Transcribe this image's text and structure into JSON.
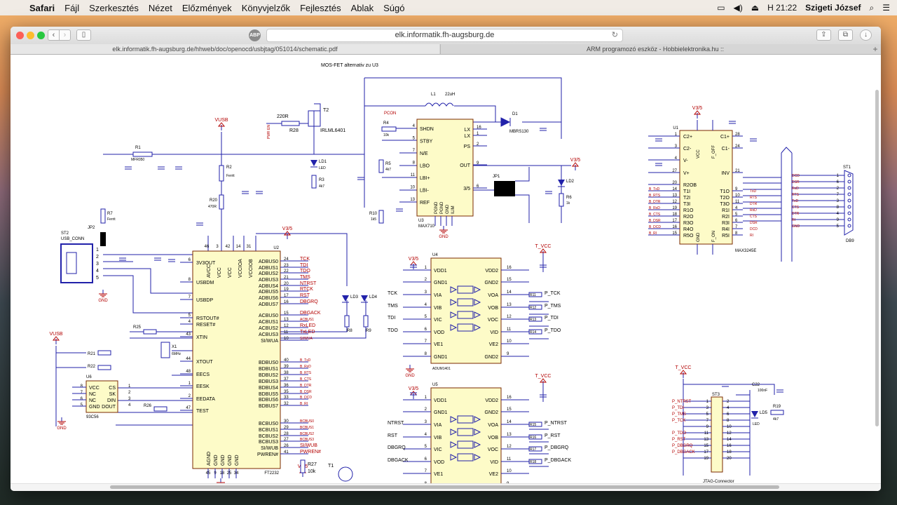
{
  "menubar": {
    "apple": "",
    "items": [
      "Safari",
      "Fájl",
      "Szerkesztés",
      "Nézet",
      "Előzmények",
      "Könyvjelzők",
      "Fejlesztés",
      "Ablak",
      "Súgó"
    ],
    "clock": "H 21:22",
    "user": "Szigeti József"
  },
  "browser": {
    "url": "elk.informatik.fh-augsburg.de",
    "adblock_label": "ABP",
    "tabs": [
      {
        "title": "elk.informatik.fh-augsburg.de/hhweb/doc/openocd/usbjtag/051014/schematic.pdf",
        "active": true
      },
      {
        "title": "ARM programozó eszköz - Hobbielektronika.hu ::",
        "active": false
      }
    ],
    "new_tab": "+"
  },
  "schematic": {
    "mosfet_note": "MOS-FET alternativ zu U3",
    "power_labels": {
      "vusb": "VUSB",
      "v3v5": "V3/5",
      "tvcc": "T_VCC"
    },
    "ft2232": {
      "ref": "U2",
      "name": "FT2232",
      "left_pins": [
        {
          "num": "6",
          "name": "3V3OUT"
        },
        {
          "num": "8",
          "name": "USBDM"
        },
        {
          "num": "7",
          "name": "USBDP"
        },
        {
          "num": "5",
          "name": "RSTOUT#"
        },
        {
          "num": "4",
          "name": "RESET#"
        },
        {
          "num": "43",
          "name": "XTIN"
        },
        {
          "num": "44",
          "name": "XTOUT"
        },
        {
          "num": "48",
          "name": "EECS"
        },
        {
          "num": "1",
          "name": "EESK"
        },
        {
          "num": "2",
          "name": "EEDATA"
        },
        {
          "num": "47",
          "name": "TEST"
        }
      ],
      "top_pins": [
        "AVCC",
        "VCC",
        "VCC",
        "VCCIOA",
        "VCCIOB"
      ],
      "top_nums": [
        "46",
        "3",
        "42",
        "14",
        "31"
      ],
      "bottom_pins": [
        "AGND",
        "GND",
        "GND",
        "GND",
        "GND"
      ],
      "bottom_nums": [
        "45",
        "9",
        "18",
        "25",
        "34"
      ],
      "right_pins": [
        {
          "num": "24",
          "name": "ADBUS0",
          "net": "TCK"
        },
        {
          "num": "23",
          "name": "ADBUS1",
          "net": "TDI"
        },
        {
          "num": "22",
          "name": "ADBUS2",
          "net": "TDO"
        },
        {
          "num": "21",
          "name": "ADBUS3",
          "net": "TMS"
        },
        {
          "num": "20",
          "name": "ADBUS4",
          "net": "NTRST"
        },
        {
          "num": "19",
          "name": "ADBUS5",
          "net": "RTCK"
        },
        {
          "num": "17",
          "name": "ADBUS6",
          "net": "RST"
        },
        {
          "num": "16",
          "name": "ADBUS7",
          "net": "DBGRQ"
        },
        {
          "num": "15",
          "name": "ACBUS0",
          "net": "DBGACK"
        },
        {
          "num": "13",
          "name": "ACBUS1",
          "net": "ACBUS1"
        },
        {
          "num": "12",
          "name": "ACBUS2",
          "net": "RxLED"
        },
        {
          "num": "11",
          "name": "ACBUS3",
          "net": "TxLED"
        },
        {
          "num": "10",
          "name": "SI/WUA",
          "net": "SI/WUA"
        },
        {
          "num": "40",
          "name": "BDBUS0",
          "net": "B_TxD"
        },
        {
          "num": "39",
          "name": "BDBUS1",
          "net": "B_RxD"
        },
        {
          "num": "38",
          "name": "BDBUS2",
          "net": "B_RTS"
        },
        {
          "num": "37",
          "name": "BDBUS3",
          "net": "B_CTS"
        },
        {
          "num": "36",
          "name": "BDBUS4",
          "net": "B_DTR"
        },
        {
          "num": "35",
          "name": "BDBUS5",
          "net": "B_DSR"
        },
        {
          "num": "33",
          "name": "BDBUS6",
          "net": "B_DCD"
        },
        {
          "num": "32",
          "name": "BDBUS7",
          "net": "B_RI"
        },
        {
          "num": "30",
          "name": "BCBUS0",
          "net": "BCBUS0"
        },
        {
          "num": "29",
          "name": "BCBUS1",
          "net": "BCBUS1"
        },
        {
          "num": "28",
          "name": "BCBUS2",
          "net": "BCBUS2"
        },
        {
          "num": "27",
          "name": "BCBUS3",
          "net": "BCBUS3"
        },
        {
          "num": "26",
          "name": "SI/WUB",
          "net": "SI/WUB"
        },
        {
          "num": "41",
          "name": "PWREN#",
          "net": "PWREN#"
        }
      ]
    },
    "max710": {
      "ref": "U3",
      "name": "MAX710",
      "left_pins": [
        {
          "num": "4",
          "name": "SHDN"
        },
        {
          "num": "5",
          "name": "STBY"
        },
        {
          "num": "7",
          "name": "N/E"
        },
        {
          "num": "8",
          "name": "LBO"
        },
        {
          "num": "11",
          "name": "LBI+"
        },
        {
          "num": "10",
          "name": "LBI-"
        },
        {
          "num": "13",
          "name": "REF"
        }
      ],
      "right_pins": [
        {
          "num": "16",
          "name": "LX"
        },
        {
          "num": "1",
          "name": "LX"
        },
        {
          "num": "2",
          "name": "PS"
        },
        {
          "num": "9",
          "name": "OUT"
        },
        {
          "num": "6",
          "name": "3/5"
        }
      ],
      "bottom_pins": [
        "PGND",
        "PGND",
        "GND",
        "ILIM"
      ],
      "net_pcon": "PCON"
    },
    "max3245": {
      "ref": "U1",
      "name": "MAX3245E",
      "left_pins": [
        {
          "num": "1",
          "name": "C2+"
        },
        {
          "num": "3",
          "name": "C2-"
        },
        {
          "num": "4",
          "name": "V-"
        },
        {
          "num": "27",
          "name": "V+"
        },
        {
          "num": "20",
          "name": "R2OB"
        },
        {
          "num": "14",
          "name": "T1I"
        },
        {
          "num": "13",
          "name": "T2I"
        },
        {
          "num": "12",
          "name": "T3I"
        },
        {
          "num": "19",
          "name": "R1O"
        },
        {
          "num": "18",
          "name": "R2O"
        },
        {
          "num": "17",
          "name": "R3O"
        },
        {
          "num": "16",
          "name": "R4O"
        },
        {
          "num": "15",
          "name": "R5O"
        }
      ],
      "left_nets": [
        "",
        "",
        "",
        "",
        "",
        "B_TxD",
        "B_RTS",
        "B_DTR",
        "B_RxD",
        "B_CTS",
        "B_DSR",
        "B_DCD",
        "B_RI"
      ],
      "right_pins": [
        {
          "num": "28",
          "name": "C1+"
        },
        {
          "num": "24",
          "name": "C1-"
        },
        {
          "num": "21",
          "name": "INV"
        },
        {
          "num": "9",
          "name": "T1O"
        },
        {
          "num": "10",
          "name": "T2O"
        },
        {
          "num": "11",
          "name": "T3O"
        },
        {
          "num": "4",
          "name": "R1I"
        },
        {
          "num": "5",
          "name": "R2I"
        },
        {
          "num": "6",
          "name": "R3I"
        },
        {
          "num": "7",
          "name": "R4I"
        },
        {
          "num": "8",
          "name": "R5I"
        }
      ],
      "right_nets": [
        "",
        "",
        "",
        "TxD",
        "RTS",
        "DTR",
        "RxD",
        "CTS",
        "DSR",
        "DCD",
        "RI"
      ],
      "top": [
        "VCC",
        "F_OFF"
      ],
      "bottom": [
        "GND",
        "F_ON"
      ]
    },
    "db9": {
      "ref": "ST1",
      "name": "DB9",
      "nets": [
        "DCD",
        "DSR",
        "RxD",
        "RTS",
        "TxD",
        "CTS",
        "DTR",
        "RI",
        "GND"
      ],
      "pins": [
        "1",
        "6",
        "2",
        "7",
        "3",
        "8",
        "4",
        "9",
        "5"
      ]
    },
    "adum_a": {
      "ref": "U4",
      "name": "ADUM1401",
      "left": [
        {
          "num": "1",
          "name": "VDD1"
        },
        {
          "num": "2",
          "name": "GND1"
        },
        {
          "num": "3",
          "name": "VIA",
          "net": "TCK"
        },
        {
          "num": "4",
          "name": "VIB",
          "net": "TMS"
        },
        {
          "num": "5",
          "name": "VIC",
          "net": "TDI"
        },
        {
          "num": "6",
          "name": "VOD",
          "net": "TDO"
        },
        {
          "num": "7",
          "name": "VE1"
        },
        {
          "num": "8",
          "name": "GND1"
        }
      ],
      "right": [
        {
          "num": "16",
          "name": "VDD2"
        },
        {
          "num": "15",
          "name": "GND2"
        },
        {
          "num": "14",
          "name": "VOA",
          "net": "P_TCK",
          "res": "R11"
        },
        {
          "num": "13",
          "name": "VOB",
          "net": "P_TMS",
          "res": "R12"
        },
        {
          "num": "12",
          "name": "VOC",
          "net": "P_TDI",
          "res": "R13"
        },
        {
          "num": "11",
          "name": "VID",
          "net": "P_TDO",
          "res": "R14"
        },
        {
          "num": "10",
          "name": "VE2"
        },
        {
          "num": "9",
          "name": "GND2"
        }
      ]
    },
    "adum_b": {
      "ref": "U5",
      "name": "ADUM1401",
      "left": [
        {
          "num": "1",
          "name": "VDD1"
        },
        {
          "num": "2",
          "name": "GND1"
        },
        {
          "num": "3",
          "name": "VIA",
          "net": "NTRST"
        },
        {
          "num": "4",
          "name": "VIB",
          "net": "RST"
        },
        {
          "num": "5",
          "name": "VIC",
          "net": "DBGRQ"
        },
        {
          "num": "6",
          "name": "VOD",
          "net": "DBGACK"
        },
        {
          "num": "7",
          "name": "VE1"
        },
        {
          "num": "8",
          "name": "GND1"
        }
      ],
      "right": [
        {
          "num": "16",
          "name": "VDD2"
        },
        {
          "num": "15",
          "name": "GND2"
        },
        {
          "num": "14",
          "name": "VOA",
          "net": "P_NTRST",
          "res": "R15"
        },
        {
          "num": "13",
          "name": "VOB",
          "net": "P_RST",
          "res": "R16"
        },
        {
          "num": "12",
          "name": "VOC",
          "net": "P_DBGRQ",
          "res": "R17"
        },
        {
          "num": "11",
          "name": "VID",
          "net": "P_DBGACK",
          "res": "R18"
        },
        {
          "num": "10",
          "name": "VE2"
        },
        {
          "num": "9",
          "name": "GND2"
        }
      ]
    },
    "jtag": {
      "ref": "ST3",
      "name": "JTAG-Connector",
      "nets": [
        "P_NTRST",
        "P_TDI",
        "P_TMS",
        "P_TCK",
        "",
        "P_TDO",
        "P_RST",
        "P_DBGRQ",
        "P_DBGACK"
      ],
      "left_nums": [
        "1",
        "3",
        "5",
        "7",
        "9",
        "11",
        "13",
        "15",
        "17",
        "19"
      ],
      "right_nums": [
        "2",
        "4",
        "6",
        "8",
        "10",
        "12",
        "14",
        "16",
        "18",
        "20"
      ]
    },
    "eeprom": {
      "ref": "U6",
      "name": "93C56",
      "left": [
        {
          "num": "8",
          "name": "VCC"
        },
        {
          "num": "7",
          "name": "NC"
        },
        {
          "num": "6",
          "name": "NC"
        },
        {
          "num": "5",
          "name": "GND"
        }
      ],
      "right": [
        {
          "num": "1",
          "name": "CS"
        },
        {
          "num": "2",
          "name": "SK"
        },
        {
          "num": "3",
          "name": "DIN"
        },
        {
          "num": "4",
          "name": "DOUT"
        }
      ]
    },
    "usb": {
      "ref": "ST2",
      "name": "USB_CONN",
      "pins": [
        "1",
        "2",
        "3",
        "4",
        "5"
      ]
    },
    "labels": {
      "inductor": "L1",
      "inductor_val": "22uH",
      "diode": "D1",
      "diode_val": "MBRS130",
      "t2": "T2",
      "t2_part": "IRLML6401",
      "r28": "R28",
      "r28_val": "220R",
      "pwren": "PWR EN",
      "t1": "T1",
      "t1_part": "BCR108",
      "r27": "R27",
      "r27_val": "10k",
      "r1": "R1",
      "r1_val": "MFR050",
      "r2": "R2",
      "r2_val": "Ferrit",
      "r7": "R7",
      "r7_val": "Ferrit",
      "jp2": "JP2",
      "jp1": "JP1",
      "r20": "R20",
      "r20_val": "470R",
      "r21": "R21",
      "r22": "R22",
      "r25": "R25",
      "r26": "R26",
      "r3": "R3",
      "r3_val": "4k7",
      "r4": "R4",
      "r4_val": "10k",
      "r5": "R5",
      "r5_val": "4k7",
      "r6": "R6",
      "r6_val": "1k",
      "r10": "R10",
      "r10_val": "1k5",
      "r8": "R8",
      "r9": "R9",
      "r19": "R19",
      "r19_val": "4k7",
      "ld1": "LD1",
      "ld2": "LD2",
      "ld3": "LD3",
      "ld4": "LD4",
      "ld5": "LD5",
      "led": "LED",
      "x1": "X1",
      "x1_val": "6MHz",
      "c22": "C22",
      "c22_val": "100nF"
    }
  }
}
